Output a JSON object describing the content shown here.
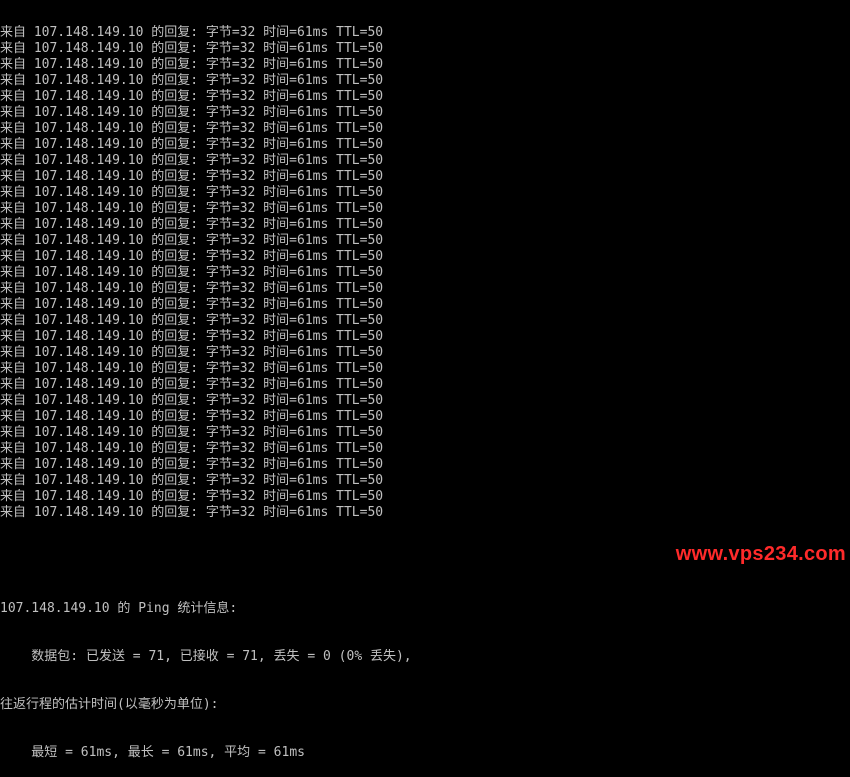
{
  "console": {
    "reply_lines": [
      "来自 107.148.149.10 的回复: 字节=32 时间=61ms TTL=50",
      "来自 107.148.149.10 的回复: 字节=32 时间=61ms TTL=50",
      "来自 107.148.149.10 的回复: 字节=32 时间=61ms TTL=50",
      "来自 107.148.149.10 的回复: 字节=32 时间=61ms TTL=50",
      "来自 107.148.149.10 的回复: 字节=32 时间=61ms TTL=50",
      "来自 107.148.149.10 的回复: 字节=32 时间=61ms TTL=50",
      "来自 107.148.149.10 的回复: 字节=32 时间=61ms TTL=50",
      "来自 107.148.149.10 的回复: 字节=32 时间=61ms TTL=50",
      "来自 107.148.149.10 的回复: 字节=32 时间=61ms TTL=50",
      "来自 107.148.149.10 的回复: 字节=32 时间=61ms TTL=50",
      "来自 107.148.149.10 的回复: 字节=32 时间=61ms TTL=50",
      "来自 107.148.149.10 的回复: 字节=32 时间=61ms TTL=50",
      "来自 107.148.149.10 的回复: 字节=32 时间=61ms TTL=50",
      "来自 107.148.149.10 的回复: 字节=32 时间=61ms TTL=50",
      "来自 107.148.149.10 的回复: 字节=32 时间=61ms TTL=50",
      "来自 107.148.149.10 的回复: 字节=32 时间=61ms TTL=50",
      "来自 107.148.149.10 的回复: 字节=32 时间=61ms TTL=50",
      "来自 107.148.149.10 的回复: 字节=32 时间=61ms TTL=50",
      "来自 107.148.149.10 的回复: 字节=32 时间=61ms TTL=50",
      "来自 107.148.149.10 的回复: 字节=32 时间=61ms TTL=50",
      "来自 107.148.149.10 的回复: 字节=32 时间=61ms TTL=50",
      "来自 107.148.149.10 的回复: 字节=32 时间=61ms TTL=50",
      "来自 107.148.149.10 的回复: 字节=32 时间=61ms TTL=50",
      "来自 107.148.149.10 的回复: 字节=32 时间=61ms TTL=50",
      "来自 107.148.149.10 的回复: 字节=32 时间=61ms TTL=50",
      "来自 107.148.149.10 的回复: 字节=32 时间=61ms TTL=50",
      "来自 107.148.149.10 的回复: 字节=32 时间=61ms TTL=50",
      "来自 107.148.149.10 的回复: 字节=32 时间=61ms TTL=50",
      "来自 107.148.149.10 的回复: 字节=32 时间=61ms TTL=50",
      "来自 107.148.149.10 的回复: 字节=32 时间=61ms TTL=50",
      "来自 107.148.149.10 的回复: 字节=32 时间=61ms TTL=50"
    ],
    "stats_header": "107.148.149.10 的 Ping 统计信息:",
    "packets_line": "    数据包: 已发送 = 71, 已接收 = 71, 丢失 = 0 (0% 丢失),",
    "rtt_header": "往返行程的估计时间(以毫秒为单位):",
    "rtt_line": "    最短 = 61ms, 最长 = 61ms, 平均 = 61ms"
  },
  "watermark": "www.vps234.com",
  "colors": {
    "background": "#000000",
    "text": "#c0c0c0",
    "watermark": "#ff2a2a"
  }
}
